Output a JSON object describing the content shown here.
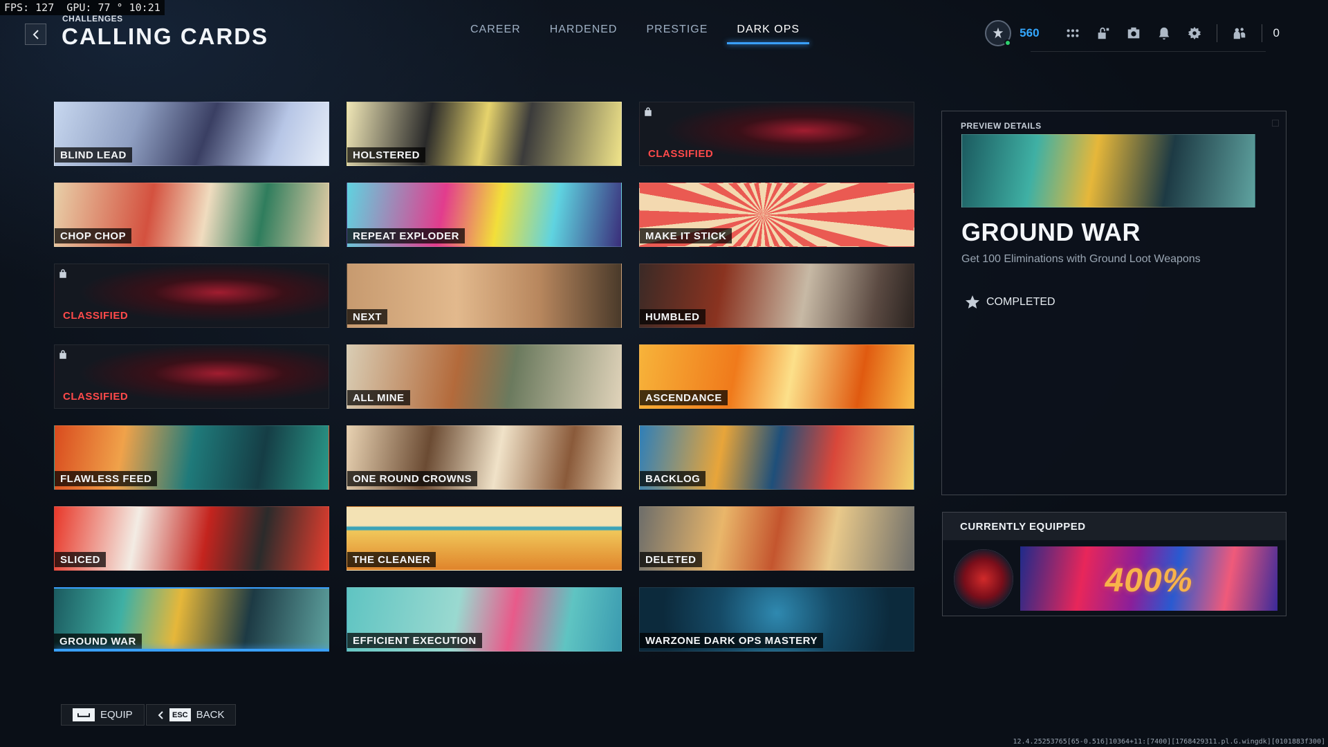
{
  "perf_overlay": "FPS: 127  GPU: 77 ° 10:21",
  "header": {
    "kicker": "CHALLENGES",
    "title": "CALLING CARDS",
    "tabs": [
      {
        "label": "CAREER",
        "active": false
      },
      {
        "label": "HARDENED",
        "active": false
      },
      {
        "label": "PRESTIGE",
        "active": false
      },
      {
        "label": "DARK OPS",
        "active": true
      }
    ]
  },
  "hud": {
    "cod_points": "560",
    "party_count": "0",
    "icons": [
      "emblem-icon",
      "apps-grid-icon",
      "store-lock-icon",
      "camera-icon",
      "bell-icon",
      "gear-icon",
      "friends-icon"
    ]
  },
  "cards": [
    {
      "label": "BLIND LEAD",
      "art": "art-blind",
      "locked": false
    },
    {
      "label": "HOLSTERED",
      "art": "art-holstered",
      "locked": false
    },
    {
      "label": "CLASSIFIED",
      "art": "art-classified",
      "locked": true
    },
    {
      "label": "CHOP CHOP",
      "art": "art-chop",
      "locked": false
    },
    {
      "label": "REPEAT EXPLODER",
      "art": "art-repeat",
      "locked": false
    },
    {
      "label": "MAKE IT STICK",
      "art": "art-stick",
      "locked": false
    },
    {
      "label": "CLASSIFIED",
      "art": "art-classified",
      "locked": true
    },
    {
      "label": "NEXT",
      "art": "art-next",
      "locked": false
    },
    {
      "label": "HUMBLED",
      "art": "art-humbled",
      "locked": false
    },
    {
      "label": "CLASSIFIED",
      "art": "art-classified",
      "locked": true
    },
    {
      "label": "ALL MINE",
      "art": "art-allmine",
      "locked": false
    },
    {
      "label": "ASCENDANCE",
      "art": "art-ascend",
      "locked": false
    },
    {
      "label": "FLAWLESS FEED",
      "art": "art-flawless",
      "locked": false
    },
    {
      "label": "ONE ROUND CROWNS",
      "art": "art-crowns",
      "locked": false
    },
    {
      "label": "BACKLOG",
      "art": "art-backlog",
      "locked": false
    },
    {
      "label": "SLICED",
      "art": "art-sliced",
      "locked": false
    },
    {
      "label": "THE CLEANER",
      "art": "art-cleaner",
      "locked": false
    },
    {
      "label": "DELETED",
      "art": "art-deleted",
      "locked": false
    },
    {
      "label": "GROUND WAR",
      "art": "art-groundwar",
      "locked": false,
      "selected": true
    },
    {
      "label": "EFFICIENT EXECUTION",
      "art": "art-efficient",
      "locked": false
    },
    {
      "label": "WARZONE DARK OPS MASTERY",
      "art": "art-mastery",
      "locked": false
    }
  ],
  "preview": {
    "section_label": "PREVIEW DETAILS",
    "title": "GROUND WAR",
    "description": "Get 100 Eliminations with Ground Loot Weapons",
    "status": "COMPLETED"
  },
  "equipped": {
    "section_label": "CURRENTLY EQUIPPED",
    "card_text": "400%"
  },
  "footer": {
    "equip_label": "EQUIP",
    "back_key": "ESC",
    "back_label": "BACK",
    "build_string": "12.4.25253765[65-0.516]10364+11:[7400][1768429311.pl.G.wingdk][0101883f300]"
  },
  "colors": {
    "accent_blue": "#3aa0ff",
    "locked_red": "#ff4a4a",
    "cp_blue": "#34a8ff"
  }
}
